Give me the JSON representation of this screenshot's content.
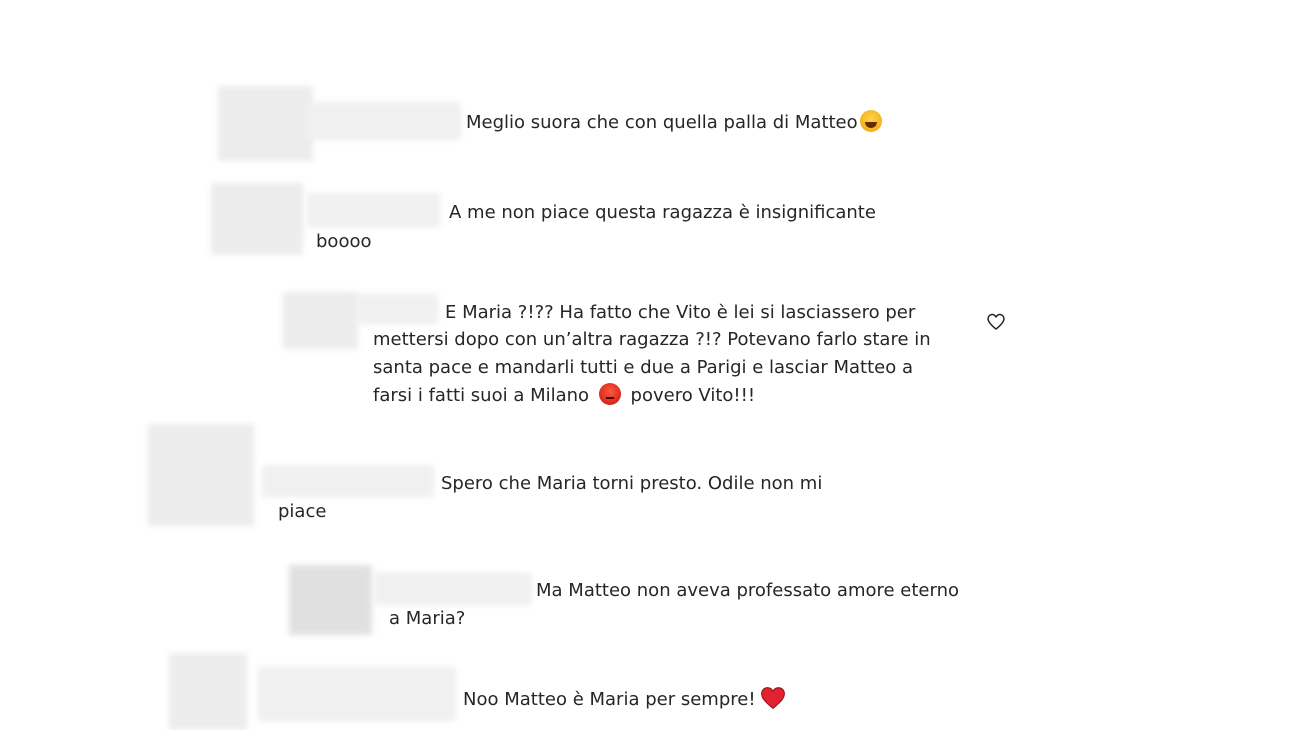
{
  "comments": [
    {
      "text": "Meglio suora che con quella palla di Matteo",
      "emoji": "laughing-emoji"
    },
    {
      "line1": "A me non piace questa ragazza è insignificante",
      "line2": "boooo"
    },
    {
      "line1": "E Maria ?!?? Ha fatto che Vito è lei si lasciassero per",
      "line2": "mettersi dopo con un’altra ragazza ?!? Potevano farlo stare in",
      "line3": "santa pace e mandarli tutti e due a Parigi e lasciar Matteo a",
      "line4a": "farsi i fatti suoi a Milano",
      "line4b": "povero Vito!!!",
      "emoji": "angry-face-emoji",
      "like_icon": "heart-outline-icon"
    },
    {
      "line1": "Spero che Maria torni presto. Odile non mi",
      "line2": "piace"
    },
    {
      "line1": "Ma Matteo non aveva professato amore eterno",
      "line2": "a Maria?"
    },
    {
      "text": "Noo Matteo è Maria per sempre!",
      "emoji": "red-heart-emoji"
    }
  ],
  "colors": {
    "text": "#262626",
    "redacted": "#f0f0f0",
    "heart_red": "#e0242f"
  }
}
